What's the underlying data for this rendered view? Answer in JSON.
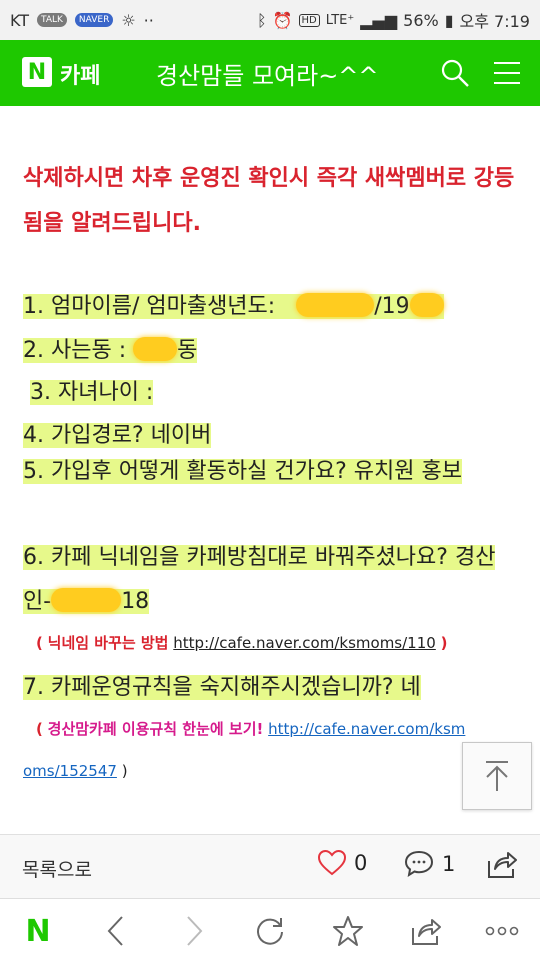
{
  "status_bar": {
    "carrier": "KT",
    "talk_badge": "TALK",
    "naver_badge": "NAVER",
    "hd_badge": "HD",
    "network": "LTE⁺",
    "battery": "56%",
    "time": "오후 7:19"
  },
  "header": {
    "logo": "N",
    "label": "카페",
    "title": "경산맘들 모여라~^^"
  },
  "post": {
    "notice": "삭제하시면 차후 운영진 확인시 즉각 새싹멤버로 강등됨을 알려드립니다.",
    "q1_text": "1. 엄마이름/ 엄마출생년도:",
    "q1_sep": "/19",
    "q2_text": "2. 사는동 :",
    "q2_suffix": "동",
    "q3_text": "3. 자녀나이 :",
    "q4_text": "4. 가입경로?  네이버",
    "q5_text": "5. 가입후 어떻게 활동하실 건가요? 유치원 홍보",
    "q6_text": "6. 카페 닉네임을 카페방침대로 바꿔주셨나요? 경산인-",
    "q6_suffix": "18",
    "nickname_paren_open": "(",
    "nickname_label": "닉네임 바꾸는 방법",
    "nickname_link": "http://cafe.naver.com/ksmoms/110",
    "nickname_paren_close": ")",
    "q7_text": "7. 카페운영규칙을 숙지해주시겠습니까? 네",
    "rules_paren_open": "(",
    "rules_label": "경산맘카페 이용규칙 한눈에 보기!",
    "rules_link_1": "http://cafe.naver.com/ksm",
    "rules_link_2": "oms/152547",
    "rules_paren_close": ")"
  },
  "actions": {
    "list_label": "목록으로",
    "like_count": "0",
    "comment_count": "1"
  },
  "colors": {
    "brand": "#1ec800",
    "notice": "#d9232e",
    "highlight": "#e7f98b",
    "link": "#1565c0"
  },
  "icons": [
    "search-icon",
    "menu-icon",
    "scroll-top-icon",
    "heart-icon",
    "comment-icon",
    "share-icon",
    "back-icon",
    "forward-icon",
    "refresh-icon",
    "star-icon",
    "more-icon"
  ]
}
